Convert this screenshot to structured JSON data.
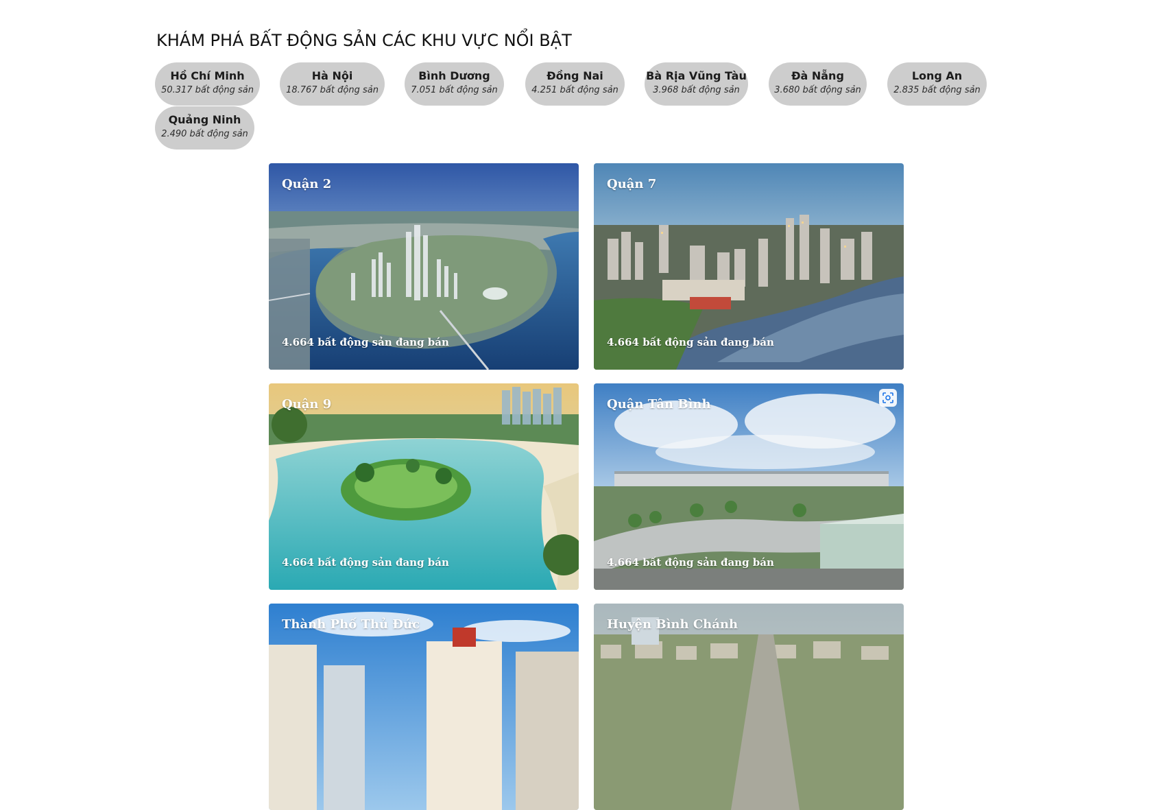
{
  "section": {
    "title": "KHÁM PHÁ BẤT ĐỘNG SẢN CÁC KHU VỰC NỔI BẬT"
  },
  "regions": [
    {
      "name": "Hồ Chí Minh",
      "count": "50.317 bất động sản"
    },
    {
      "name": "Hà Nội",
      "count": "18.767 bất động sản"
    },
    {
      "name": "Bình Dương",
      "count": "7.051 bất động sản"
    },
    {
      "name": "Đồng Nai",
      "count": "4.251 bất động sản"
    },
    {
      "name": "Bà Rịa Vũng Tàu",
      "count": "3.968 bất động sản"
    },
    {
      "name": "Đà Nẵng",
      "count": "3.680 bất động sản"
    },
    {
      "name": "Long An",
      "count": "2.835 bất động sản"
    },
    {
      "name": "Quảng Ninh",
      "count": "2.490 bất động sản"
    }
  ],
  "districts": [
    {
      "name": "Quận 2",
      "count": "4.664 bất động sản đang bán"
    },
    {
      "name": "Quận 7",
      "count": "4.664 bất động sản đang bán"
    },
    {
      "name": "Quận 9",
      "count": "4.664 bất động sản đang bán"
    },
    {
      "name": "Quận Tân Bình",
      "count": "4.664 bất động sản đang bán"
    },
    {
      "name": "Thành Phố Thủ Đức",
      "count": ""
    },
    {
      "name": "Huyện Bình Chánh",
      "count": ""
    }
  ],
  "icons": {
    "lens": "visual-search-icon"
  },
  "colors": {
    "chip_background": "#cdcdcd",
    "card_text": "#ffffff"
  }
}
